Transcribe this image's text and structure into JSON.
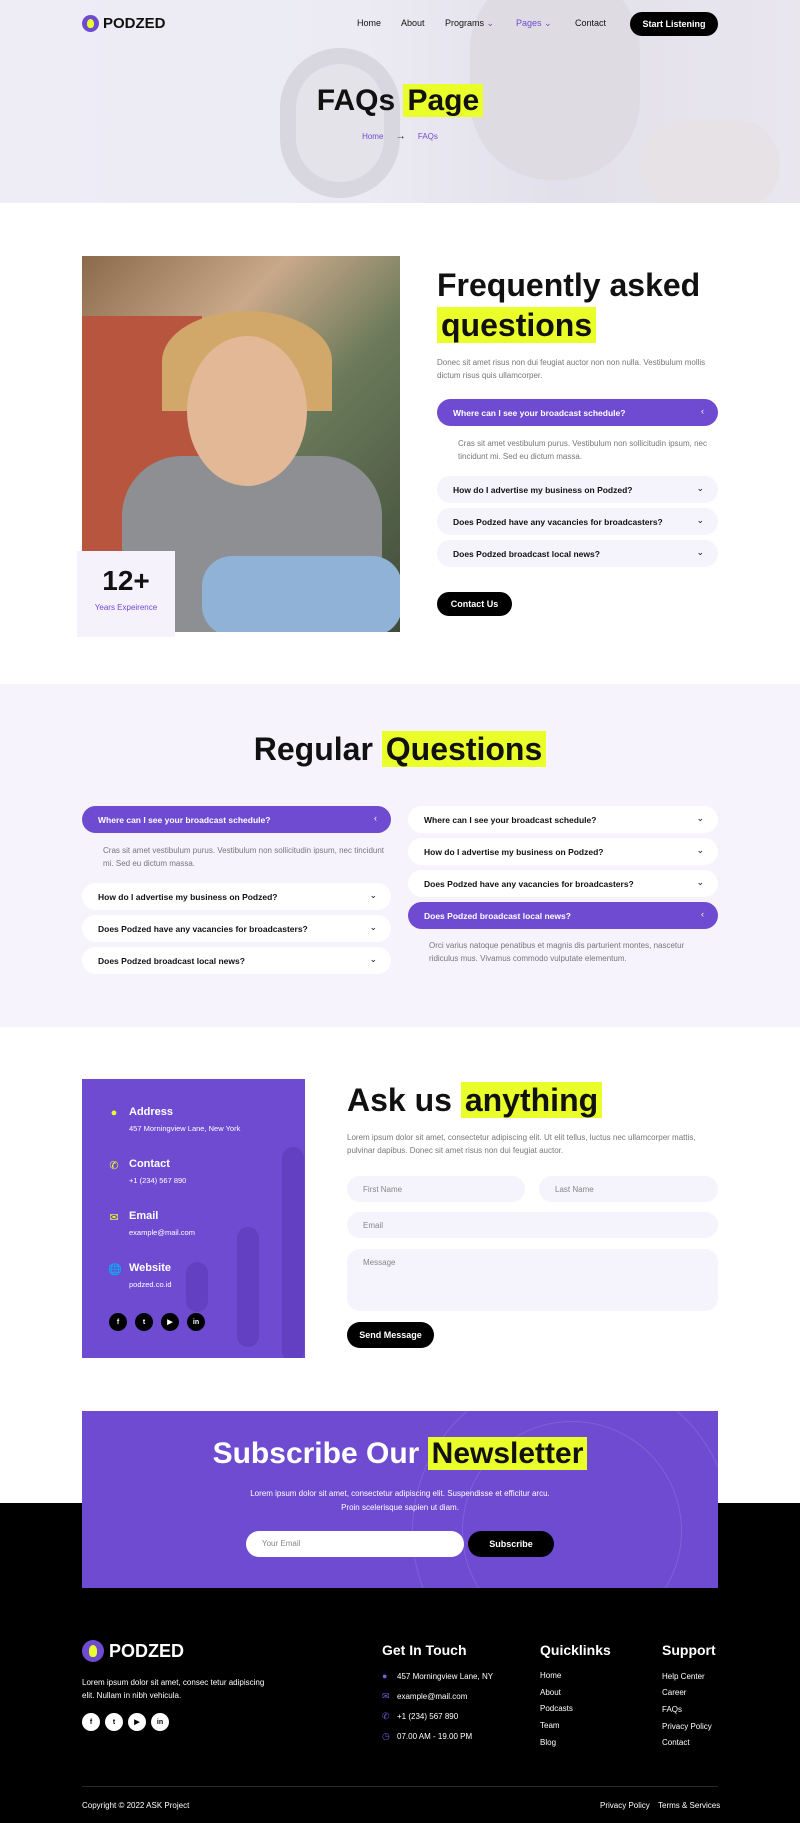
{
  "header": {
    "logo_text": "PODZED",
    "nav": [
      "Home",
      "About",
      "Programs",
      "Pages",
      "Contact"
    ],
    "cta": "Start Listening",
    "title_plain": "FAQs",
    "title_highlight": "Page",
    "breadcrumb_home": "Home",
    "breadcrumb_current": "FAQs",
    "arrow_icon": "→"
  },
  "faq": {
    "experience_number": "12+",
    "experience_label": "Years Expeirence",
    "heading_line1": "Frequently asked",
    "heading_highlight": "questions",
    "intro": "Donec sit amet risus non dui feugiat auctor non non nulla. Vestibulum mollis dictum risus quis ullamcorper.",
    "items": [
      "Where can I see your broadcast schedule?",
      "How do I advertise my business on Podzed?",
      "Does Podzed have any vacancies for broadcasters?",
      "Does Podzed broadcast local news?"
    ],
    "answer": "Cras sit amet vestibulum purus. Vestibulum non sollicitudin ipsum, nec tincidunt mi. Sed eu dictum massa.",
    "contact_button": "Contact Us"
  },
  "regular": {
    "heading_plain": "Regular",
    "heading_highlight": "Questions",
    "left": [
      "Where can I see your broadcast schedule?",
      "How do I advertise my business on Podzed?",
      "Does Podzed have any vacancies for broadcasters?",
      "Does Podzed broadcast local news?"
    ],
    "left_answer": "Cras sit amet vestibulum purus. Vestibulum non sollicitudin ipsum, nec tincidunt mi. Sed eu dictum massa.",
    "right": [
      "Where can I see your broadcast schedule?",
      "How do I advertise my business on Podzed?",
      "Does Podzed have any vacancies for broadcasters?",
      "Does Podzed broadcast local news?"
    ],
    "right_answer": "Orci varius natoque penatibus et magnis dis parturient montes, nascetur ridiculus mus. Vivamus commodo vulputate elementum."
  },
  "contact": {
    "address_title": "Address",
    "address_value": "457 Morningview Lane, New York",
    "phone_title": "Contact",
    "phone_value": "+1 (234) 567 890",
    "email_title": "Email",
    "email_value": "example@mail.com",
    "website_title": "Website",
    "website_value": "podzed.co.id",
    "heading_plain": "Ask us",
    "heading_highlight": "anything",
    "intro": "Lorem ipsum dolor sit amet, consectetur adipiscing elit. Ut elit tellus, luctus nec ullamcorper mattis, pulvinar dapibus. Donec sit amet risus non dui feugiat auctor.",
    "first_name_placeholder": "First Name",
    "last_name_placeholder": "Last Name",
    "email_placeholder": "Email",
    "message_placeholder": "Message",
    "send_button": "Send Message"
  },
  "newsletter": {
    "heading_plain": "Subscribe Our",
    "heading_highlight": "Newsletter",
    "line1": "Lorem ipsum dolor sit amet, consectetur adipiscing elit. Suspendisse et efficitur arcu.",
    "line2": "Proin scelerisque sapien ut diam.",
    "email_placeholder": "Your Email",
    "button": "Subscribe"
  },
  "footer": {
    "logo_text": "PODZED",
    "about": "Lorem ipsum dolor sit amet, consec tetur adipiscing elit. Nullam in nibh vehicula.",
    "touch_title": "Get In Touch",
    "touch": [
      "457 Morningview Lane, NY",
      "example@mail.com",
      "+1 (234) 567 890",
      "07.00 AM - 19.00 PM"
    ],
    "quick_title": "Quicklinks",
    "quick": [
      "Home",
      "About",
      "Podcasts",
      "Team",
      "Blog"
    ],
    "support_title": "Support",
    "support": [
      "Help Center",
      "Career",
      "FAQs",
      "Privacy Policy",
      "Contact"
    ],
    "copyright": "Copyright © 2022 ASK Project",
    "privacy": "Privacy Policy",
    "terms": "Terms & Services"
  },
  "colors": {
    "accent": "#6f4bd1",
    "highlight": "#eaff2a",
    "dark": "#000000"
  }
}
